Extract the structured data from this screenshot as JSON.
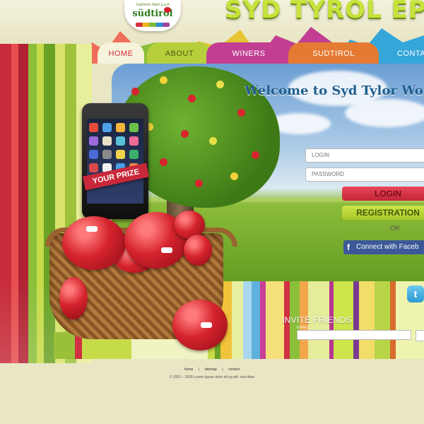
{
  "site": {
    "title": "SYD TYROL EPLER",
    "logo_tagline": "Südtiroler Äpfel g.g.A",
    "logo_word": "südtirol"
  },
  "nav": {
    "items": [
      {
        "label": "HOME"
      },
      {
        "label": "ABOUT"
      },
      {
        "label": "WINERS"
      },
      {
        "label": "SUDTIROL"
      },
      {
        "label": "CONTA"
      }
    ]
  },
  "hero": {
    "welcome": "Welcome to Syd Tylor World",
    "prize_label": "YOUR PRIZE"
  },
  "login": {
    "login_placeholder": "LOGIN",
    "password_placeholder": "PASSWORD",
    "login_button": "LOGIN",
    "registration_button": "REGISTRATION",
    "or_text": "OR",
    "facebook_f": "f",
    "facebook_button": "Connect with Faceb"
  },
  "invite": {
    "title": "INVITE FRIENDS",
    "email_label": "EMAIL"
  },
  "twitter_glyph": "t",
  "footer": {
    "links": [
      "home",
      "sitemap",
      "contact"
    ],
    "separator": "|",
    "copyright": "© 2001 – 2009 Lorem ipsum dolor sit ng ath, sed diam"
  },
  "colors": {
    "brand_red": "#c22638",
    "brand_green": "#a7c82a",
    "sky_blue": "#6c9ed4",
    "facebook_blue": "#3b5998",
    "twitter_blue": "#2a9ad2"
  }
}
